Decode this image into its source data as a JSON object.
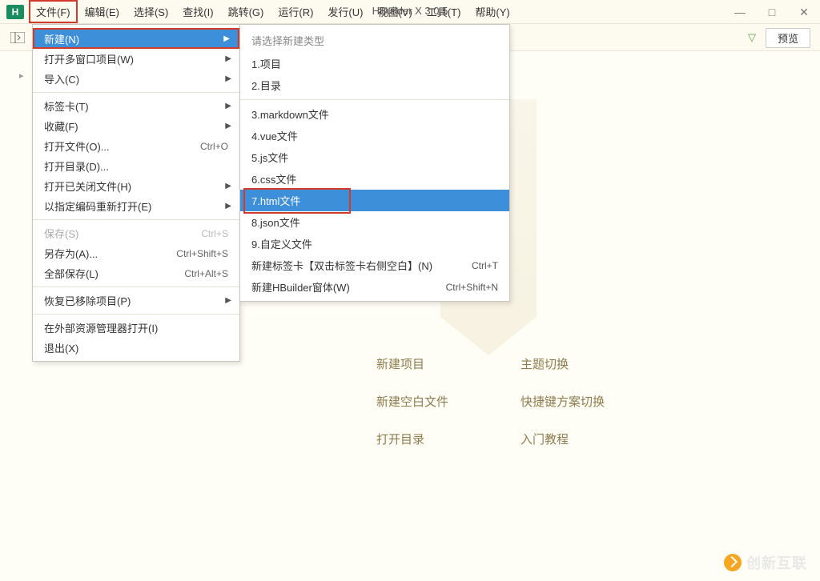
{
  "app": {
    "icon_letter": "H",
    "title": "HBuilder X 3.0.5"
  },
  "menubar": [
    {
      "label": "文件(F)",
      "active": true
    },
    {
      "label": "编辑(E)"
    },
    {
      "label": "选择(S)"
    },
    {
      "label": "查找(I)"
    },
    {
      "label": "跳转(G)"
    },
    {
      "label": "运行(R)"
    },
    {
      "label": "发行(U)"
    },
    {
      "label": "视图(V)"
    },
    {
      "label": "工具(T)"
    },
    {
      "label": "帮助(Y)"
    }
  ],
  "win_controls": {
    "min": "—",
    "max": "□",
    "close": "✕"
  },
  "toolbar": {
    "preview": "预览",
    "filter_icon": "▽"
  },
  "file_menu": [
    {
      "label": "新建(N)",
      "arrow": true,
      "highlight": true
    },
    {
      "label": "打开多窗口项目(W)",
      "arrow": true
    },
    {
      "label": "导入(C)",
      "arrow": true
    },
    {
      "sep": true
    },
    {
      "label": "标签卡(T)",
      "arrow": true
    },
    {
      "label": "收藏(F)",
      "arrow": true
    },
    {
      "label": "打开文件(O)...",
      "shortcut": "Ctrl+O"
    },
    {
      "label": "打开目录(D)..."
    },
    {
      "label": "打开已关闭文件(H)",
      "arrow": true
    },
    {
      "label": "以指定编码重新打开(E)",
      "arrow": true
    },
    {
      "sep": true
    },
    {
      "label": "保存(S)",
      "shortcut": "Ctrl+S",
      "disabled": true
    },
    {
      "label": "另存为(A)...",
      "shortcut": "Ctrl+Shift+S"
    },
    {
      "label": "全部保存(L)",
      "shortcut": "Ctrl+Alt+S"
    },
    {
      "sep": true
    },
    {
      "label": "恢复已移除项目(P)",
      "arrow": true
    },
    {
      "sep": true
    },
    {
      "label": "在外部资源管理器打开(I)"
    },
    {
      "label": "退出(X)"
    }
  ],
  "submenu": {
    "header": "请选择新建类型",
    "items": [
      {
        "label": "1.项目"
      },
      {
        "label": "2.目录"
      },
      {
        "sep": true
      },
      {
        "label": "3.markdown文件"
      },
      {
        "label": "4.vue文件"
      },
      {
        "label": "5.js文件"
      },
      {
        "label": "6.css文件"
      },
      {
        "label": "7.html文件",
        "highlight": true
      },
      {
        "label": "8.json文件"
      },
      {
        "label": "9.自定义文件"
      },
      {
        "label": "新建标签卡【双击标签卡右侧空白】(N)",
        "shortcut": "Ctrl+T"
      },
      {
        "label": "新建HBuilder窗体(W)",
        "shortcut": "Ctrl+Shift+N"
      }
    ]
  },
  "welcome_links": {
    "r0c0": "新建项目",
    "r0c1": "主题切换",
    "r1c0": "新建空白文件",
    "r1c1": "快捷键方案切换",
    "r2c0": "打开目录",
    "r2c1": "入门教程"
  },
  "watermark": "创新互联"
}
